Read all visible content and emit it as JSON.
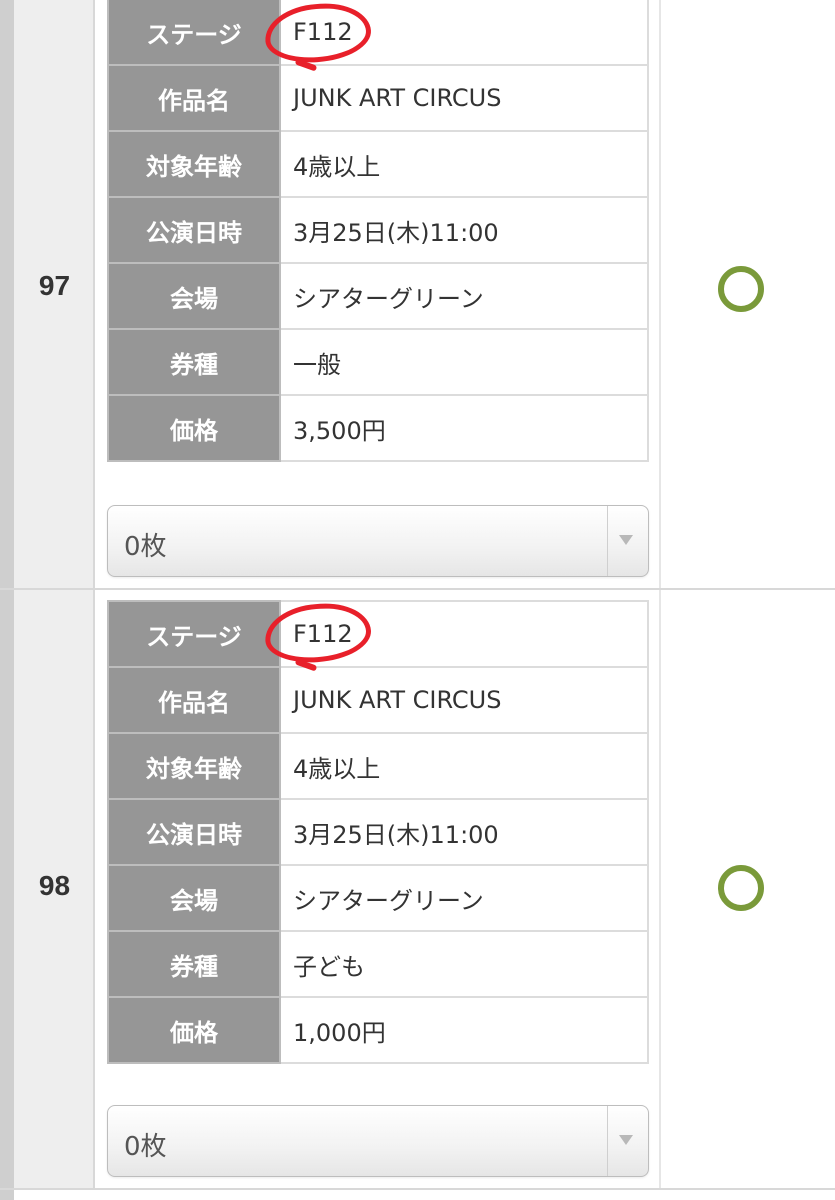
{
  "entries": [
    {
      "number": "97",
      "stage_label": "ステージ",
      "stage": "F112",
      "title_label": "作品名",
      "title": "JUNK ART CIRCUS",
      "age_label": "対象年齢",
      "age": "4歳以上",
      "datetime_label": "公演日時",
      "datetime": "3月25日(木)11:00",
      "venue_label": "会場",
      "venue": "シアターグリーン",
      "ticket_type_label": "券種",
      "ticket_type": "一般",
      "price_label": "価格",
      "price": "3,500円",
      "quantity": "0枚",
      "availability_icon": "circle-available-icon"
    },
    {
      "number": "98",
      "stage_label": "ステージ",
      "stage": "F112",
      "title_label": "作品名",
      "title": "JUNK ART CIRCUS",
      "age_label": "対象年齢",
      "age": "4歳以上",
      "datetime_label": "公演日時",
      "datetime": "3月25日(木)11:00",
      "venue_label": "会場",
      "venue": "シアターグリーン",
      "ticket_type_label": "券種",
      "ticket_type": "子ども",
      "price_label": "価格",
      "price": "1,000円",
      "quantity": "0枚",
      "availability_icon": "circle-available-icon"
    }
  ],
  "colors": {
    "label_bg": "#969696",
    "available_circle": "#7a9a3a",
    "highlight_mark": "#e8202a"
  }
}
